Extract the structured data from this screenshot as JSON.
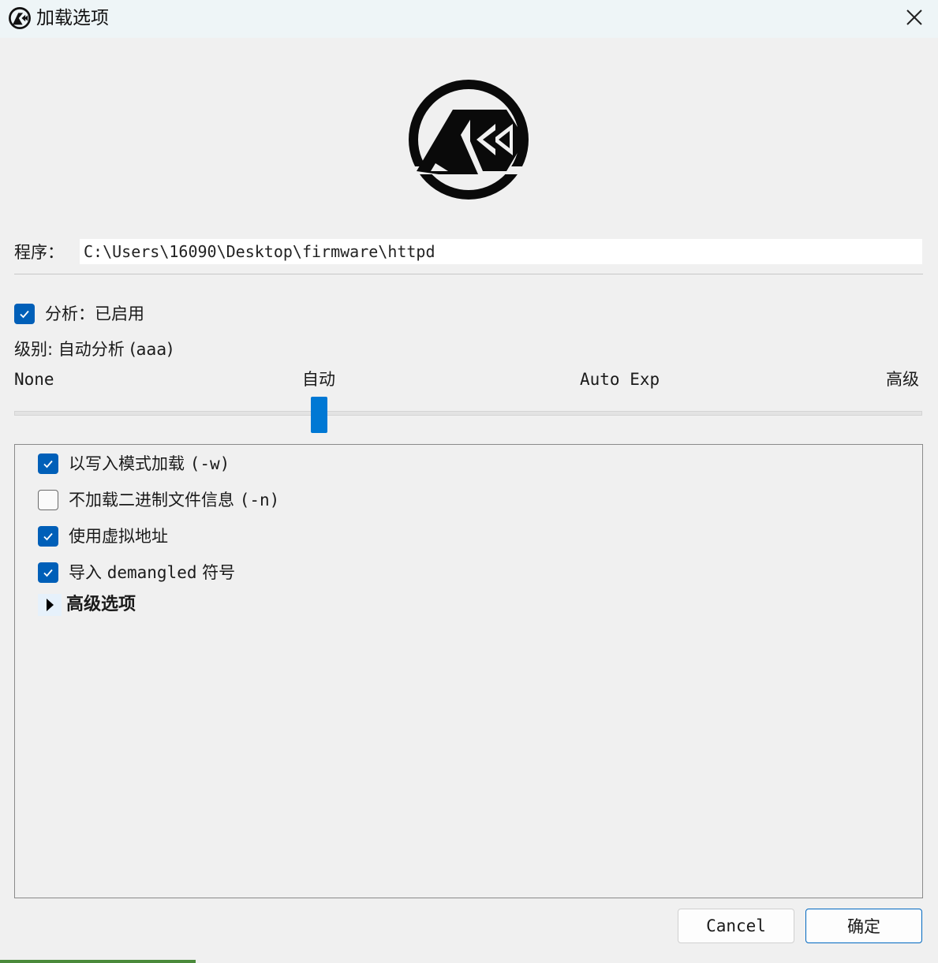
{
  "window": {
    "title": "加载选项",
    "app_icon": "cutter-logo-icon",
    "close_icon": "close-icon"
  },
  "program": {
    "label": "程序：",
    "path": "C:\\Users\\16090\\Desktop\\firmware\\httpd"
  },
  "analysis": {
    "checkbox_label": "分析：已启用",
    "checked": true,
    "level_label": "级别: 自动分析 (aaa)",
    "ticks": [
      "None",
      "自动",
      "Auto Exp",
      "高级"
    ],
    "selected_tick": "自动"
  },
  "options": [
    {
      "label_cn": "以写入模式加载 ",
      "label_mono": "(-w)",
      "checked": true
    },
    {
      "label_cn": "不加载二进制文件信息 ",
      "label_mono": "(-n)",
      "checked": false
    },
    {
      "label_cn": "使用虚拟地址",
      "label_mono": "",
      "checked": true
    },
    {
      "label_cn": "导入 ",
      "label_mono": "demangled",
      "label_tail": " 符号",
      "checked": true
    }
  ],
  "advanced": {
    "label": "高级选项",
    "expanded": false
  },
  "buttons": {
    "cancel": "Cancel",
    "ok": "确定"
  },
  "colors": {
    "accent": "#005fb8",
    "slider_thumb": "#0078d4",
    "titlebar": "#eef5f7"
  }
}
